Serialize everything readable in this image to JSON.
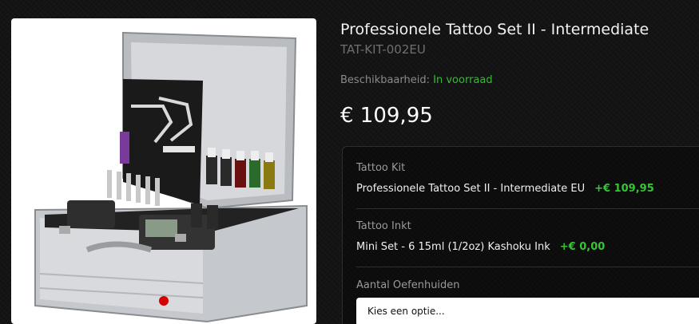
{
  "product": {
    "title": "Professionele Tattoo Set II - Intermediate",
    "sku": "TAT-KIT-002EU",
    "availability_label": "Beschikbaarheid:",
    "availability_value": "In voorraad",
    "price": "€ 109,95",
    "image_name": "tattoo-kit-case-photo"
  },
  "options": [
    {
      "label": "Tattoo Kit",
      "value": "Professionele Tattoo Set II - Intermediate EU",
      "delta": "+€ 109,95"
    },
    {
      "label": "Tattoo Inkt",
      "value": "Mini Set - 6 15ml (1/2oz) Kashoku Ink",
      "delta": "+€ 0,00"
    },
    {
      "label": "Aantal Oefenhuiden",
      "placeholder": "Kies een optie..."
    }
  ],
  "colors": {
    "background": "#141414",
    "in_stock": "#2fbf2f",
    "price_delta": "#35c535",
    "carousel_dot": "#d40000"
  }
}
